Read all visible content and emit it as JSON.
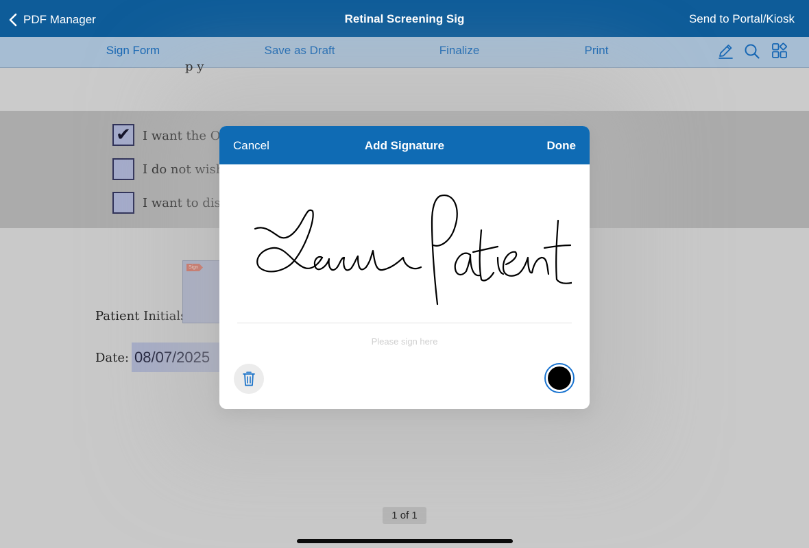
{
  "nav": {
    "back_label": "PDF Manager",
    "title": "Retinal Screening Sig",
    "right_action": "Send to Portal/Kiosk"
  },
  "toolbar": {
    "items": [
      {
        "label": "Sign Form"
      },
      {
        "label": "Save as Draft"
      },
      {
        "label": "Finalize"
      },
      {
        "label": "Print"
      }
    ],
    "icons": [
      "pencil-icon",
      "search-icon",
      "grid-icon"
    ]
  },
  "document": {
    "partial_top_text": "p y",
    "options": [
      {
        "label": "I want the OC",
        "checked": true
      },
      {
        "label": "I do not wish",
        "checked": false
      },
      {
        "label": "I want to disc",
        "checked": false
      }
    ],
    "checkmark": "✔",
    "initials_label": "Patient Initials:",
    "initials_tag": "Sign",
    "date_label": "Date:",
    "date_value": "08/07/2025",
    "page_indicator": "1 of 1"
  },
  "modal": {
    "cancel_label": "Cancel",
    "title": "Add Signature",
    "done_label": "Done",
    "hint": "Please sign here",
    "ink_color": "#000000"
  },
  "colors": {
    "nav_bg": "#0e5c99",
    "toolbar_bg": "#a6bdd3",
    "accent": "#1767b4",
    "modal_header_bg": "#0f6bb4"
  }
}
